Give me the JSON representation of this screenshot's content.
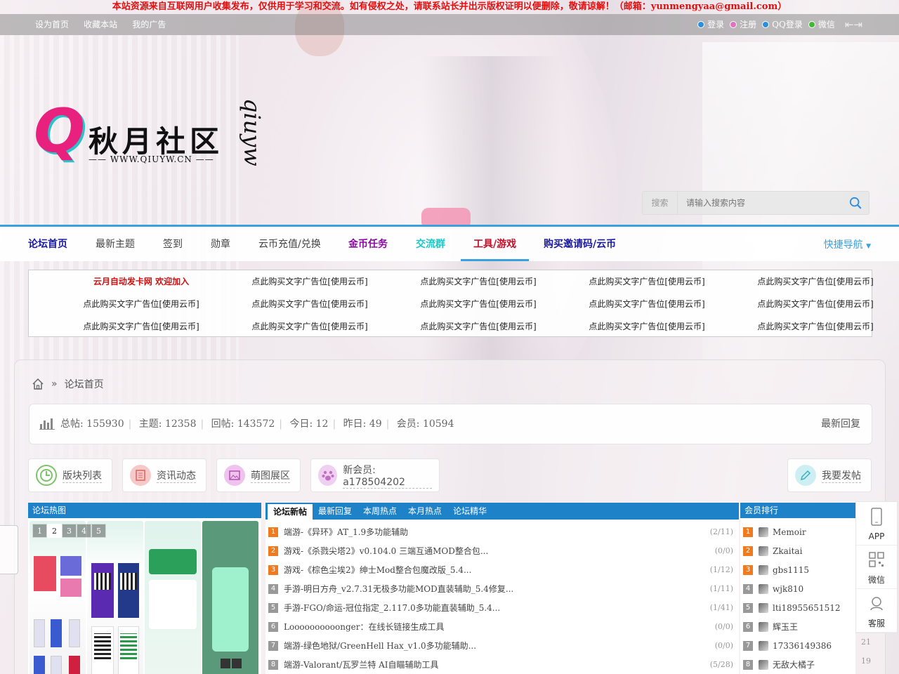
{
  "notice": "本站资源来自互联网用户收集发布，仅供用于学习和交流。如有侵权之处，请联系站长并出示版权证明以便删除，敬请谅解！（邮箱：yunmengyaa@gmail.com）",
  "topbar": {
    "left": [
      "设为首页",
      "收藏本站",
      "我的广告"
    ],
    "right": [
      {
        "label": "登录",
        "color": "#2b8fe0"
      },
      {
        "label": "注册",
        "color": "#e070c0"
      },
      {
        "label": "QQ登录",
        "color": "#2b8fe0"
      },
      {
        "label": "微信",
        "color": "#44b834"
      }
    ]
  },
  "logo": {
    "name": "秋月社区",
    "url": "—— WWW.QIUYW.CN ——",
    "sig": "qiuyw"
  },
  "search": {
    "label": "搜索",
    "placeholder": "请输入搜索内容"
  },
  "nav": {
    "items": [
      {
        "label": "论坛首页",
        "color": "#1a1aa0",
        "bold": true
      },
      {
        "label": "最新主题",
        "color": "#444"
      },
      {
        "label": "签到",
        "color": "#444"
      },
      {
        "label": "勋章",
        "color": "#444"
      },
      {
        "label": "云币充值/兑换",
        "color": "#444"
      },
      {
        "label": "金币任务",
        "color": "#8a0aa0",
        "bold": true
      },
      {
        "label": "交流群",
        "color": "#19c8c8",
        "bold": true
      },
      {
        "label": "工具/游戏",
        "color": "#c0102a",
        "bold": true
      },
      {
        "label": "购买邀请码/云币",
        "color": "#1a1aa0",
        "bold": true
      }
    ],
    "quick": "快捷导航"
  },
  "ads": {
    "first": "云月自动发卡网 欢迎加入",
    "text": "点此购买文字广告位[使用云币]"
  },
  "breadcrumb": {
    "current": "论坛首页"
  },
  "stats": {
    "total": "总帖: 155930",
    "threads": "主题: 12358",
    "replies": "回帖: 143572",
    "today": "今日: 12",
    "yesterday": "昨日: 49",
    "members": "会员: 10594",
    "latest": "最新回复"
  },
  "quick_buttons": {
    "forums": "版块列表",
    "news": "资讯动态",
    "gallery": "萌图展区",
    "newmember": "新会员: a178504202",
    "post": "我要发帖"
  },
  "hot": {
    "title": "论坛热图",
    "pages": [
      "1",
      "2",
      "3",
      "4",
      "5"
    ]
  },
  "new_tabs": [
    "论坛新帖",
    "最新回复",
    "本周热点",
    "本月热点",
    "论坛精华"
  ],
  "threads": [
    {
      "n": "1",
      "title": "端游-《异环》AT_1.9多功能辅助",
      "count": "(2/11)"
    },
    {
      "n": "2",
      "title": "游戏-《杀戮尖塔2》v0.104.0 三端互通MOD整合包...",
      "count": "(0/0)"
    },
    {
      "n": "3",
      "title": "游戏-《棕色尘埃2》绅士Mod整合包魔改版_5.4...",
      "count": "(1/12)"
    },
    {
      "n": "4",
      "title": "手游-明日方舟_v2.7.31无极多功能MOD直装辅助_5.4修复...",
      "count": "(1/11)"
    },
    {
      "n": "5",
      "title": "手游-FGO/命运-冠位指定_2.117.0多功能直装辅助_5.4...",
      "count": "(1/41)"
    },
    {
      "n": "6",
      "title": "Loooooooooonger：在线长链接生成工具",
      "count": "(0/0)"
    },
    {
      "n": "7",
      "title": "端游-绿色地狱/GreenHell Hax_v1.0多功能辅助...",
      "count": "(0/0)"
    },
    {
      "n": "8",
      "title": "端游-Valorant/瓦罗兰特 AI自瞄辅助工具",
      "count": "(5/28)"
    }
  ],
  "rank": {
    "title": "会员排行",
    "members": [
      {
        "n": "1",
        "name": "Memoir"
      },
      {
        "n": "2",
        "name": "Zkaitai"
      },
      {
        "n": "3",
        "name": "gbs1115"
      },
      {
        "n": "4",
        "name": "wjk810"
      },
      {
        "n": "5",
        "name": "lti18955651512"
      },
      {
        "n": "6",
        "name": "辉玉王"
      },
      {
        "n": "7",
        "name": "17336149386"
      },
      {
        "n": "8",
        "name": "无敌大橘子"
      }
    ],
    "tail_nums": [
      "21",
      "19"
    ]
  },
  "float": {
    "app": "APP",
    "wechat": "微信",
    "service": "客服"
  }
}
